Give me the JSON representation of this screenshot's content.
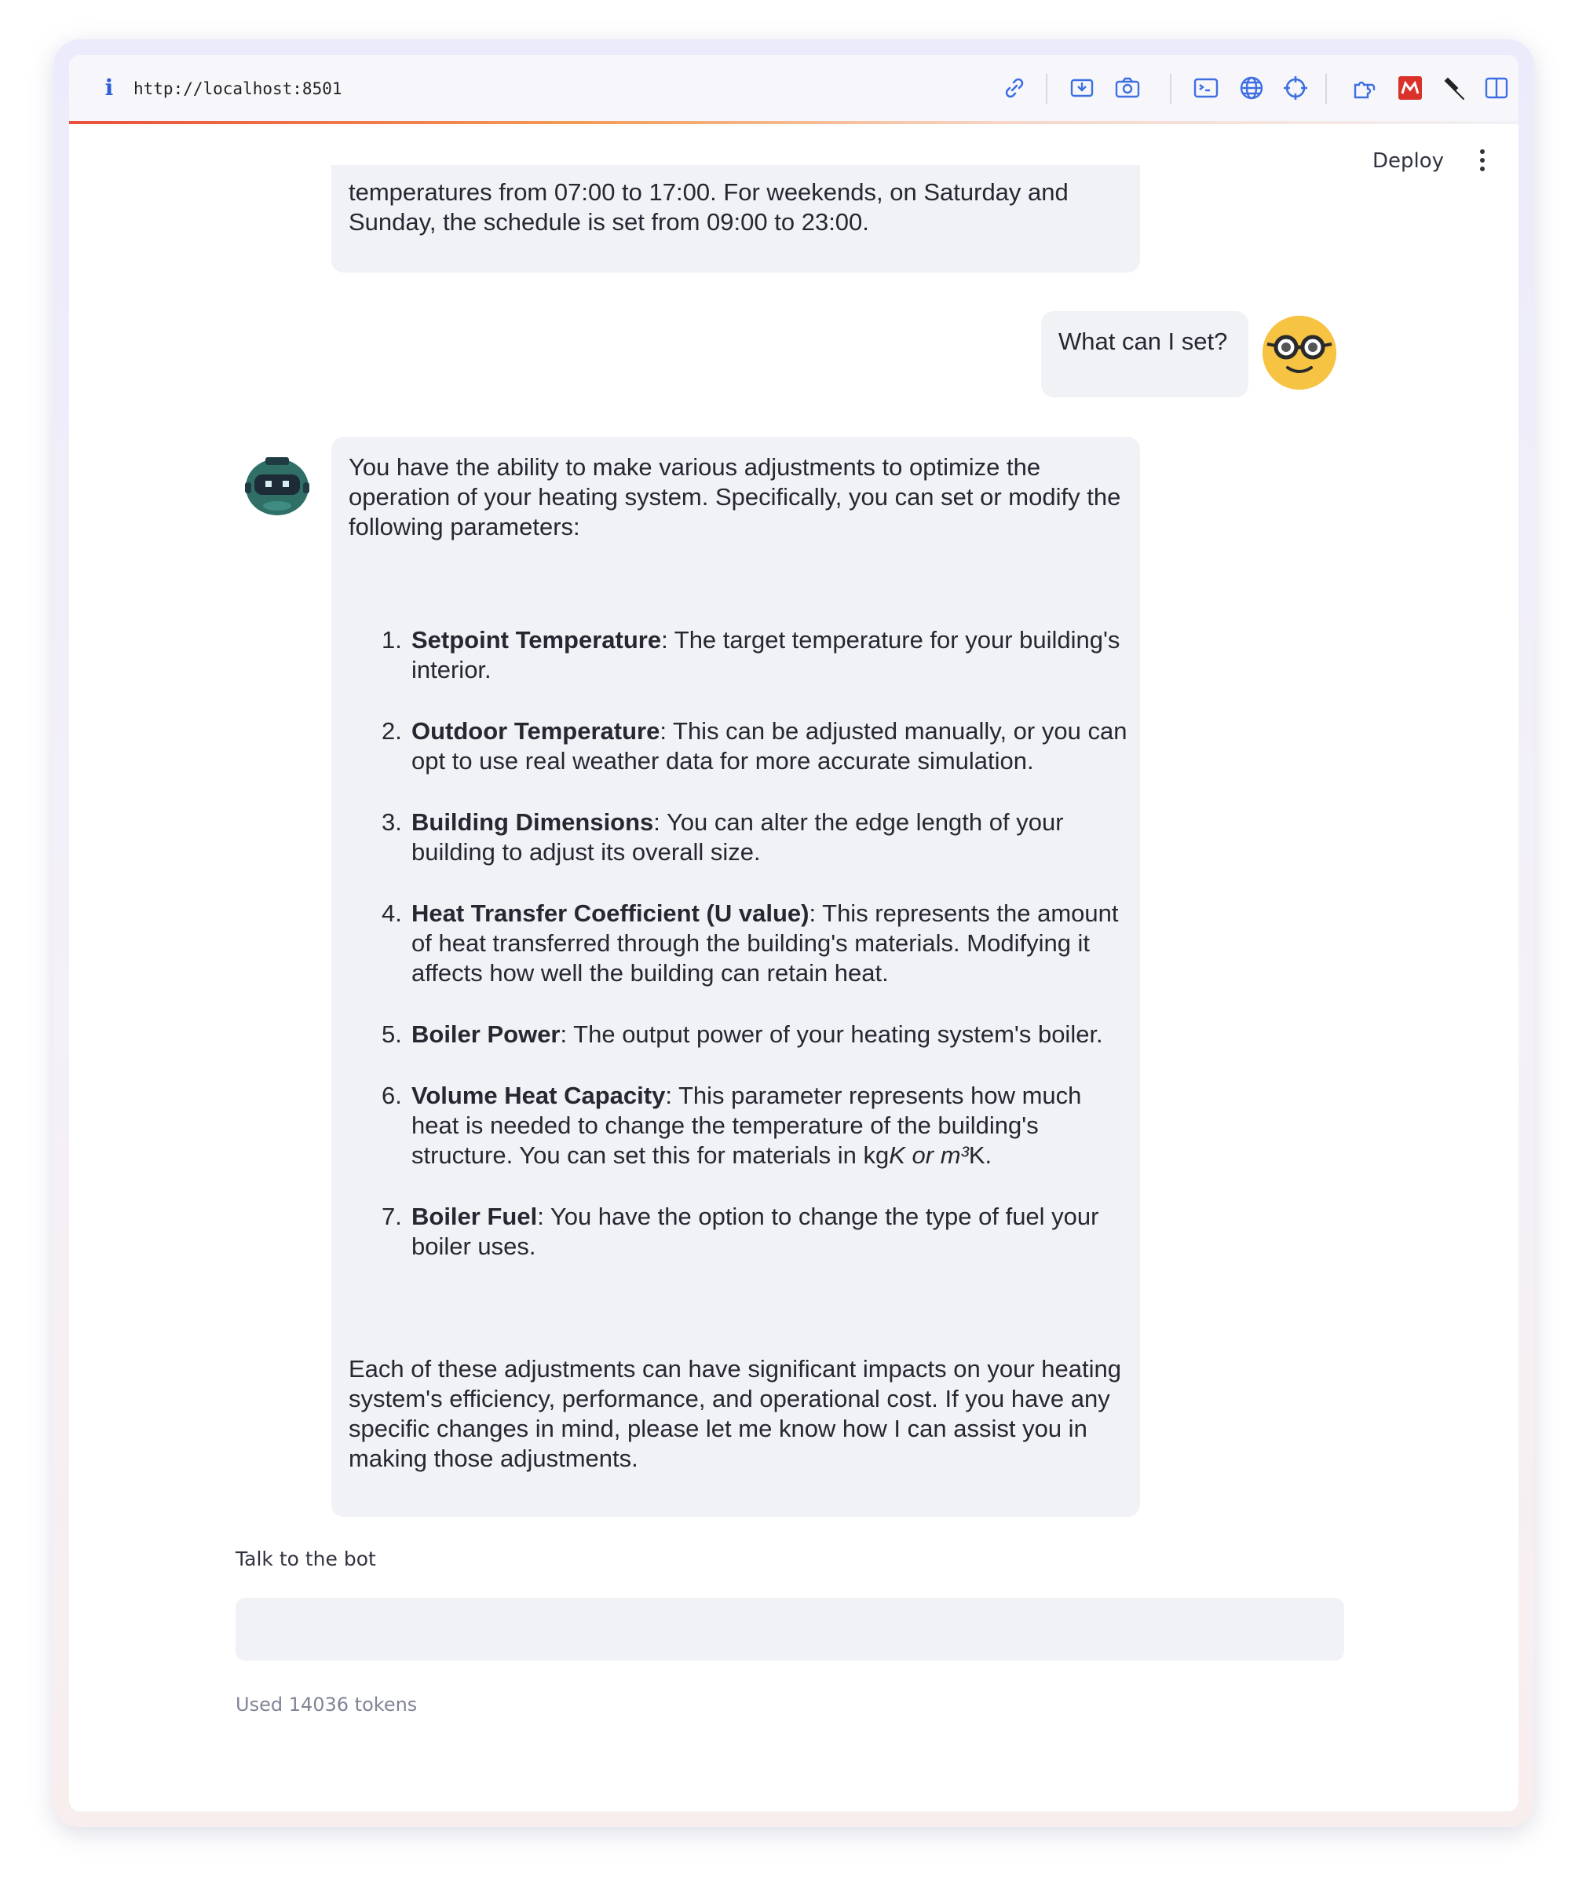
{
  "browser": {
    "url": "http://localhost:8501",
    "icons": [
      "info-icon",
      "link-icon",
      "screen-capture-icon",
      "camera-icon",
      "terminal-icon",
      "globe-icon",
      "crosshair-icon",
      "extension-icon",
      "red-extension-icon",
      "pin-icon",
      "sidebar-toggle-icon"
    ]
  },
  "header": {
    "deploy_label": "Deploy"
  },
  "messages": {
    "assistant_prev": "temperatures from 07:00 to 17:00. For weekends, on Saturday and Sunday, the schedule is set from 09:00 to 23:00.",
    "user": "What can I set?",
    "assistant": {
      "intro": "You have the ability to make various adjustments to optimize the operation of your heating system. Specifically, you can set or modify the following parameters:",
      "items": [
        {
          "num": "1.",
          "title": "Setpoint Temperature",
          "text": ": The target temperature for your building's interior."
        },
        {
          "num": "2.",
          "title": "Outdoor Temperature",
          "text": ": This can be adjusted manually, or you can opt to use real weather data for more accurate simulation."
        },
        {
          "num": "3.",
          "title": "Building Dimensions",
          "text": ": You can alter the edge length of your building to adjust its overall size."
        },
        {
          "num": "4.",
          "title": "Heat Transfer Coefficient (U value)",
          "text": ": This represents the amount of heat transferred through the building's materials. Modifying it affects how well the building can retain heat."
        },
        {
          "num": "5.",
          "title": "Boiler Power",
          "text": ": The output power of your heating system's boiler."
        },
        {
          "num": "6.",
          "title": "Volume Heat Capacity",
          "text": ": This parameter represents how much heat is needed to change the temperature of the building's structure. You can set this for materials in kg",
          "text_italic": "K or m³",
          "text_end": "K."
        },
        {
          "num": "7.",
          "title": "Boiler Fuel",
          "text": ": You have the option to change the type of fuel your boiler uses."
        }
      ],
      "outro": "Each of these adjustments can have significant impacts on your heating system's efficiency, performance, and operational cost. If you have any specific changes in mind, please let me know how I can assist you in making those adjustments."
    }
  },
  "chat_input": {
    "label": "Talk to the bot",
    "value": ""
  },
  "footer": {
    "tokens_text": "Used 14036 tokens"
  },
  "colors": {
    "bubble_bg": "#f0f2f6",
    "text": "#262730",
    "muted": "#808495",
    "accent_gradient_start": "#ea4f3b",
    "user_avatar": "#f6c343",
    "bot_avatar": "#2f6f66"
  }
}
